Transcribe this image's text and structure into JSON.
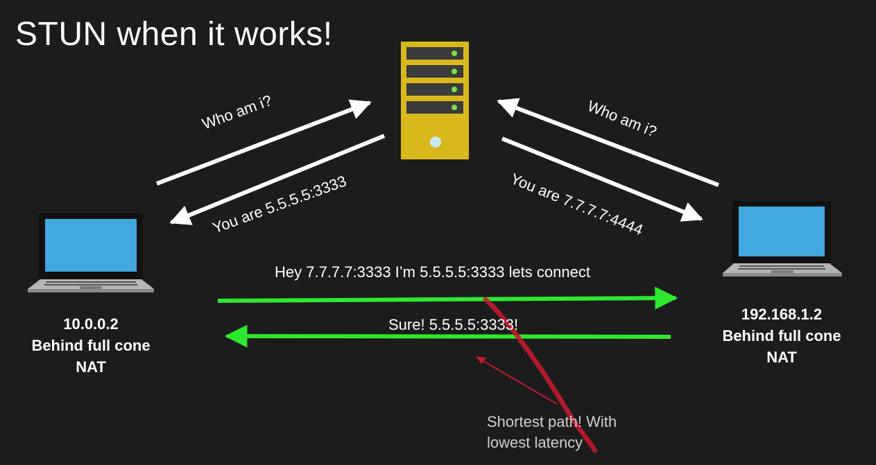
{
  "title": "STUN when it works!",
  "left_host": {
    "ip": "10.0.0.2",
    "label_line1": "Behind full cone",
    "label_line2": "NAT"
  },
  "right_host": {
    "ip": "192.168.1.2",
    "label_line1": "Behind full cone",
    "label_line2": "NAT"
  },
  "messages": {
    "left_request": "Who am i?",
    "left_response": "You are 5.5.5.5:3333",
    "right_request": "Who am i?",
    "right_response": "You are 7.7.7.7:4444",
    "peer_request": "Hey 7.7.7.7:3333 I’m 5.5.5.5:3333 lets connect",
    "peer_response": "Sure! 5.5.5.5:3333!"
  },
  "annotation": {
    "line1": "Shortest path! With",
    "line2": "lowest latency"
  },
  "colors": {
    "background": "#1c1c1c",
    "server": "#d9b81c",
    "laptop_screen": "#41a7df",
    "peer_arrow": "#2ee82e",
    "annotation_ink": "#c01a2e",
    "status_led": "#7be04a"
  },
  "icons": [
    "server-icon",
    "laptop-icon"
  ]
}
